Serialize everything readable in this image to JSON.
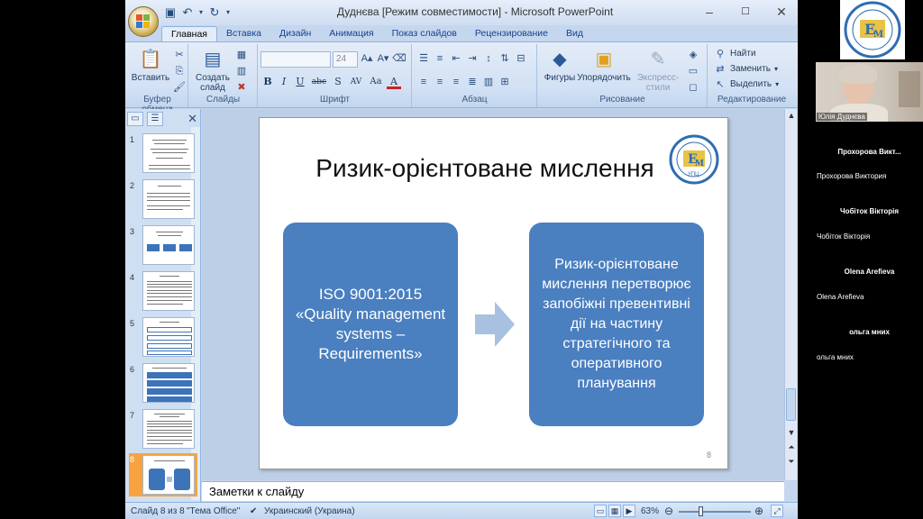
{
  "window": {
    "title": "Дуднєва [Режим совместимости] - Microsoft PowerPoint",
    "controls": [
      "–",
      "☐",
      "✕"
    ]
  },
  "ribbon": {
    "tabs": [
      "Главная",
      "Вставка",
      "Дизайн",
      "Анимация",
      "Показ слайдов",
      "Рецензирование",
      "Вид"
    ],
    "active_tab": "Главная",
    "groups": {
      "clipboard": {
        "label": "Буфер обмена",
        "paste": "Вставить"
      },
      "slides": {
        "label": "Слайды",
        "new_slide_1": "Создать",
        "new_slide_2": "слайд"
      },
      "font": {
        "label": "Шрифт",
        "size": "24",
        "buttons": [
          "B",
          "I",
          "U",
          "abc",
          "S",
          "AV",
          "Aa",
          "A"
        ]
      },
      "paragraph": {
        "label": "Абзац"
      },
      "drawing": {
        "label": "Рисование",
        "shapes": "Фигуры",
        "arrange": "Упорядочить",
        "quick_styles": "Экспресс-стили"
      },
      "editing": {
        "label": "Редактирование",
        "find": "Найти",
        "replace": "Заменить",
        "select": "Выделить"
      }
    }
  },
  "thumbnails": [
    {
      "num": "1"
    },
    {
      "num": "2"
    },
    {
      "num": "3"
    },
    {
      "num": "4"
    },
    {
      "num": "5"
    },
    {
      "num": "6"
    },
    {
      "num": "7"
    },
    {
      "num": "8"
    }
  ],
  "slide": {
    "title": "Ризик-орієнтоване мислення",
    "left_box": "ISO 9001:2015 «Quality management systems – Requirements»",
    "right_box": "Ризик-орієнтоване мислення перетворює запобіжні превентивні дії на частину стратегічного та оперативного планування",
    "number": "8",
    "logo_text": "УПЦ",
    "box_color": "#4a7fc0",
    "arrow_color": "#a9c1e0"
  },
  "notes": {
    "placeholder": "Заметки к слайду"
  },
  "status": {
    "slide_info": "Слайд 8 из 8",
    "theme": "\"Тема Office\"",
    "language": "Украинский (Украина)",
    "zoom": "63%"
  },
  "participants": [
    {
      "label": "Юлія Дуднєва"
    },
    {
      "tile": "Прохорова Викт...",
      "label": "Прохорова Виктория"
    },
    {
      "tile": "Чобіток Вікторія",
      "label": "Чобіток Вікторія"
    },
    {
      "tile": "Olena Arefieva",
      "label": "Olena Arefieva"
    },
    {
      "tile": "ольга мних",
      "label": "ольга мних"
    }
  ]
}
